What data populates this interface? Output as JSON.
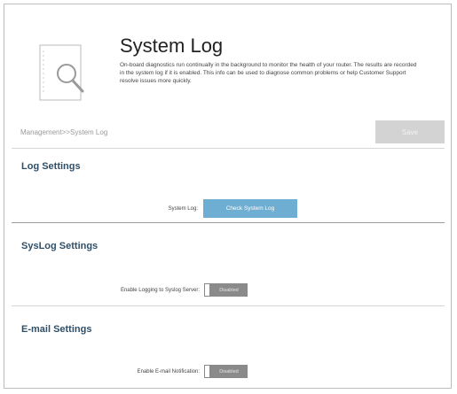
{
  "header": {
    "title": "System Log",
    "description": "On-board diagnostics run continually in the background to monitor the health of your router. The results are recorded in the system log if it is enabled. This info can be used to diagnose common problems or help Customer Support resolve issues more quickly."
  },
  "breadcrumb": "Management>>System Log",
  "toolbar": {
    "save_label": "Save"
  },
  "log_settings": {
    "title": "Log Settings",
    "system_log_label": "System Log:",
    "check_button_label": "Check System Log"
  },
  "syslog_settings": {
    "title": "SysLog Settings",
    "enable_label": "Enable Logging to Syslog Server:",
    "toggle_state": "Disabled"
  },
  "email_settings": {
    "title": "E-mail Settings",
    "enable_label": "Enable E-mail Notification:",
    "toggle_state": "Disabled"
  },
  "icons": {
    "hero": "notebook-magnifier-icon"
  },
  "colors": {
    "accent_button": "#6eaed2",
    "section_title": "#2f4f68",
    "save_disabled": "#d3d3d3"
  }
}
